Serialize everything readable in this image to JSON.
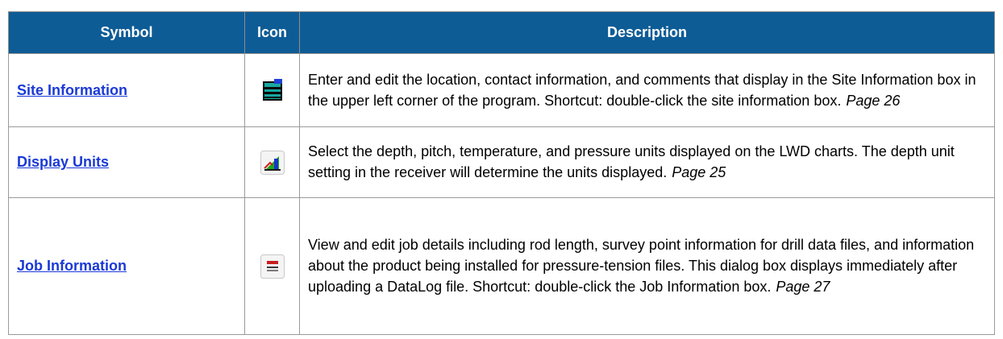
{
  "table": {
    "headers": [
      "Symbol",
      "Icon",
      "Description"
    ],
    "rows": [
      {
        "symbol": "Site Information",
        "icon": "site-information-icon",
        "description": "Enter and edit the location, contact information, and comments that display in the Site Information box in the upper left corner of the program. Shortcut: double-click the site information box.",
        "page": "Page 26"
      },
      {
        "symbol": "Display Units",
        "icon": "display-units-icon",
        "description": "Select the depth, pitch, temperature, and pressure units displayed on the LWD charts. The depth unit setting in the receiver will determine the units displayed.",
        "page": "Page 25"
      },
      {
        "symbol": "Job Information",
        "icon": "job-information-icon",
        "description": "View and edit job details including rod length, survey point information for drill data files, and information about the product being installed for pressure-tension files. This dialog box displays immediately after uploading a DataLog file. Shortcut: double-click the Job Information box.",
        "page": "Page 27"
      }
    ]
  },
  "colors": {
    "header_bg": "#0e5c96",
    "header_text": "#ffffff",
    "link": "#1a39d6",
    "border": "#9a9a9a"
  }
}
